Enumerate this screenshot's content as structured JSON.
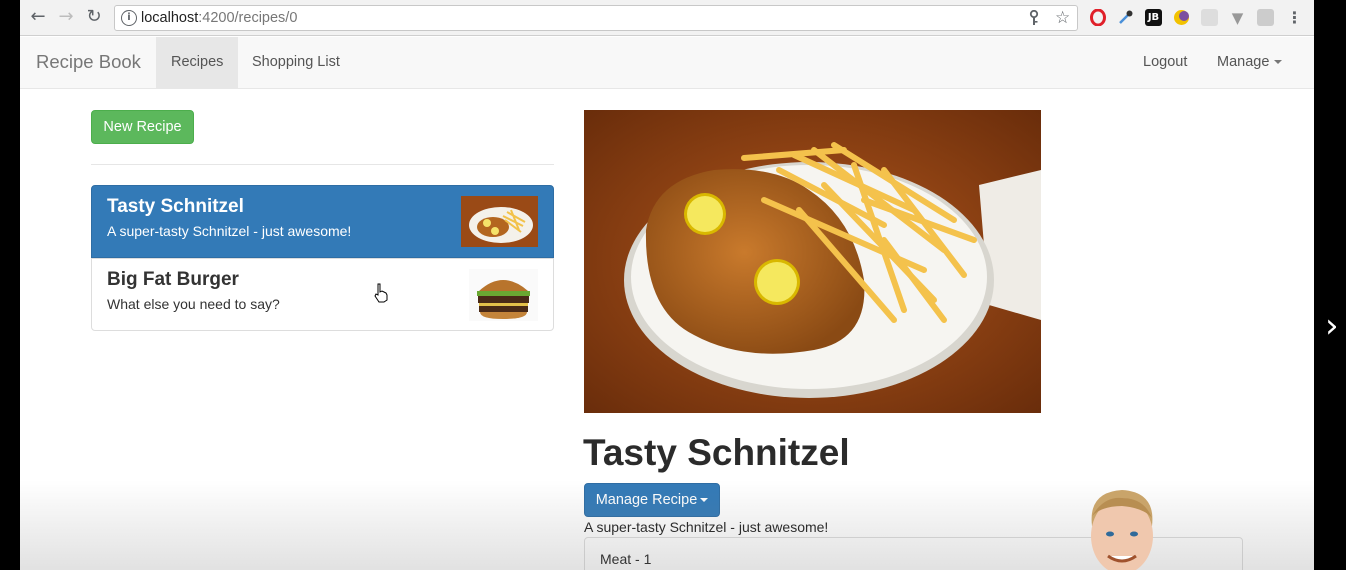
{
  "browser": {
    "url_host": "localhost",
    "url_path": ":4200/recipes/0",
    "info_glyph": "i",
    "icons": [
      "back-icon",
      "forward-icon",
      "reload-icon",
      "key-icon",
      "star-icon",
      "opera-icon",
      "eyedropper-icon",
      "jetbrains-icon",
      "moon-icon",
      "grid-icon",
      "vue-icon",
      "chat-icon",
      "menu-icon"
    ],
    "ext_jb": "JB"
  },
  "navbar": {
    "brand": "Recipe Book",
    "links": [
      "Recipes",
      "Shopping List"
    ],
    "right": {
      "logout": "Logout",
      "manage": "Manage"
    }
  },
  "list": {
    "new_button": "New Recipe",
    "items": [
      {
        "name": "Tasty Schnitzel",
        "description": "A super-tasty Schnitzel - just awesome!",
        "selected": true
      },
      {
        "name": "Big Fat Burger",
        "description": "What else you need to say?",
        "selected": false
      }
    ]
  },
  "detail": {
    "title": "Tasty Schnitzel",
    "manage_button": "Manage Recipe",
    "description": "A super-tasty Schnitzel - just awesome!",
    "ingredients": [
      "Meat - 1"
    ]
  },
  "colors": {
    "success": "#5cb85c",
    "primary": "#337ab7",
    "navbar": "#f8f8f8"
  }
}
